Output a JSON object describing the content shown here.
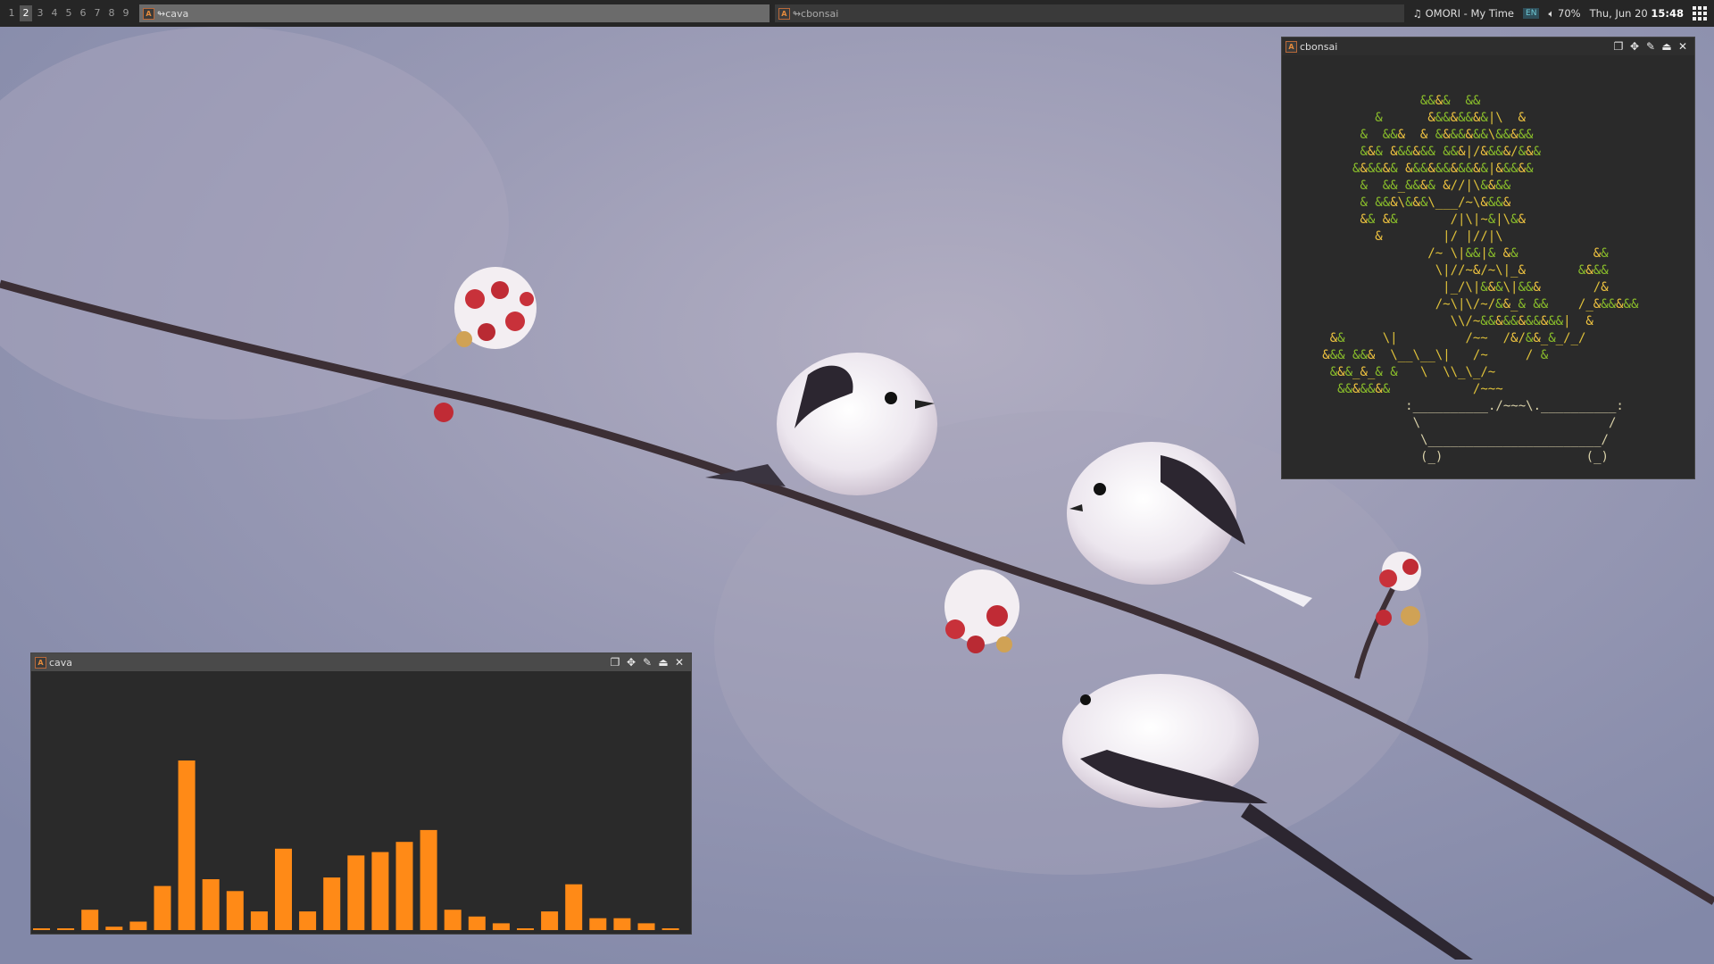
{
  "workspaces": [
    "1",
    "2",
    "3",
    "4",
    "5",
    "6",
    "7",
    "8",
    "9"
  ],
  "active_workspace_index": 1,
  "taskbar": {
    "task1_label": "cava",
    "task2_label": "cbonsai",
    "task_prefix": "↬",
    "app_icon_letter": "A"
  },
  "tray": {
    "music_icon": "music-note-icon",
    "now_playing": "OMORI - My Time",
    "language": "EN",
    "volume_icon": "speaker-icon",
    "volume": "70%",
    "date": "Thu, Jun 20",
    "time": "15:48",
    "apps_icon": "app-grid-icon"
  },
  "windows": {
    "cbonsai": {
      "title": "cbonsai",
      "controls": [
        "restore-icon",
        "move-icon",
        "pin-icon",
        "maximize-icon",
        "close-icon"
      ]
    },
    "cava": {
      "title": "cava",
      "controls": [
        "restore-icon",
        "move-icon",
        "pin-icon",
        "maximize-icon",
        "close-icon"
      ],
      "bar_color": "#ff8a17",
      "bar_levels": [
        0.01,
        0.01,
        0.12,
        0.02,
        0.05,
        0.26,
        1.0,
        0.3,
        0.23,
        0.11,
        0.48,
        0.11,
        0.31,
        0.44,
        0.46,
        0.52,
        0.59,
        0.12,
        0.08,
        0.04,
        0.01,
        0.11,
        0.27,
        0.07,
        0.07,
        0.04,
        0.01
      ]
    }
  },
  "bonsai_ascii": [
    "                &&&&  &&",
    "          &      &&&&&&&&|\\  &",
    "        &  &&&  & &&&&&&&\\&&&&&",
    "        &&& &&&&&& &&&|/&&&&/&&&",
    "       &&&&&& &&&&&&&&&&&|&&&&&",
    "        &  &&_&&&& &//|\\&&&&",
    "        & &&&\\&&&\\___/~\\&&&&",
    "        && &&       /|\\|~&|\\&&",
    "          &        |/ |//|\\",
    "                 /~ \\|&&|& &&          &&",
    "                  \\|//~&/~\\|_&       &&&&",
    "                   |_/\\|&&&\\|&&&       /&",
    "                  /~\\|\\/~/&&_& &&    /_&&&&&&",
    "                    \\\\/~&&&&&&&&&&&|  &",
    "    &&     \\|         /~~  /&/&&_&_/_/",
    "   &&& &&&  \\__\\__\\|   /~     / &",
    "    &&&_&_& &   \\  \\\\_\\_/~",
    "     &&&&&&&           /~~~",
    "              :__________./~~~\\.__________:",
    "               \\                         /",
    "                \\_______________________/",
    "                (_)                   (_)"
  ]
}
